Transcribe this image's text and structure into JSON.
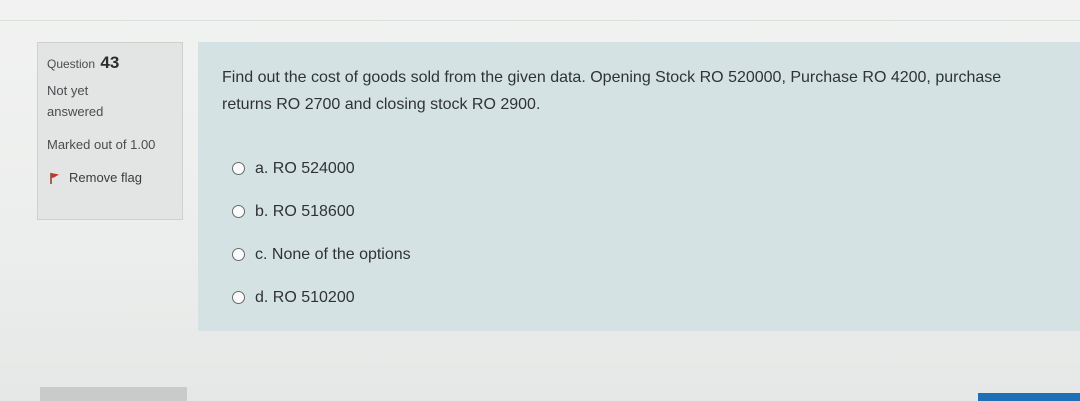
{
  "question_info": {
    "question_label": "Question",
    "question_number": "43",
    "status": "Not yet answered",
    "marked": "Marked out of 1.00",
    "flag_label": "Remove flag"
  },
  "question": {
    "text": "Find out the cost of goods sold from the given data. Opening Stock RO 520000, Purchase RO 4200, purchase returns RO 2700 and closing stock RO 2900.",
    "options": [
      {
        "label": "a. RO 524000"
      },
      {
        "label": "b. RO 518600"
      },
      {
        "label": "c. None of the options"
      },
      {
        "label": "d. RO 510200"
      }
    ]
  },
  "colors": {
    "panel_background": "#d5e2e3",
    "info_background": "#e3e4e4",
    "flag_red": "#c0392b",
    "accent_blue": "#1d6fb8"
  },
  "icons": {
    "flag": "flag-icon"
  }
}
